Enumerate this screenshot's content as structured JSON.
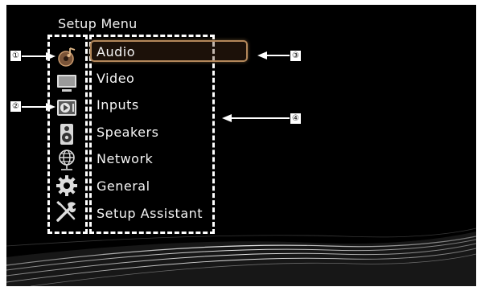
{
  "setup_menu": {
    "title": "Setup Menu",
    "items": [
      {
        "label": "Audio",
        "icon": "audio-icon",
        "selected": true
      },
      {
        "label": "Video",
        "icon": "video-monitor-icon",
        "selected": false
      },
      {
        "label": "Inputs",
        "icon": "inputs-icon",
        "selected": false
      },
      {
        "label": "Speakers",
        "icon": "speaker-icon",
        "selected": false
      },
      {
        "label": "Network",
        "icon": "globe-network-icon",
        "selected": false
      },
      {
        "label": "General",
        "icon": "gear-icon",
        "selected": false
      },
      {
        "label": "Setup Assistant",
        "icon": "tools-icon",
        "selected": false
      }
    ]
  },
  "callouts": [
    "①",
    "②",
    "③",
    "④"
  ],
  "colors": {
    "background": "#000000",
    "highlight_border": "#b3875a",
    "text": "#f5f5f5",
    "dashed_border": "#ffffff"
  }
}
